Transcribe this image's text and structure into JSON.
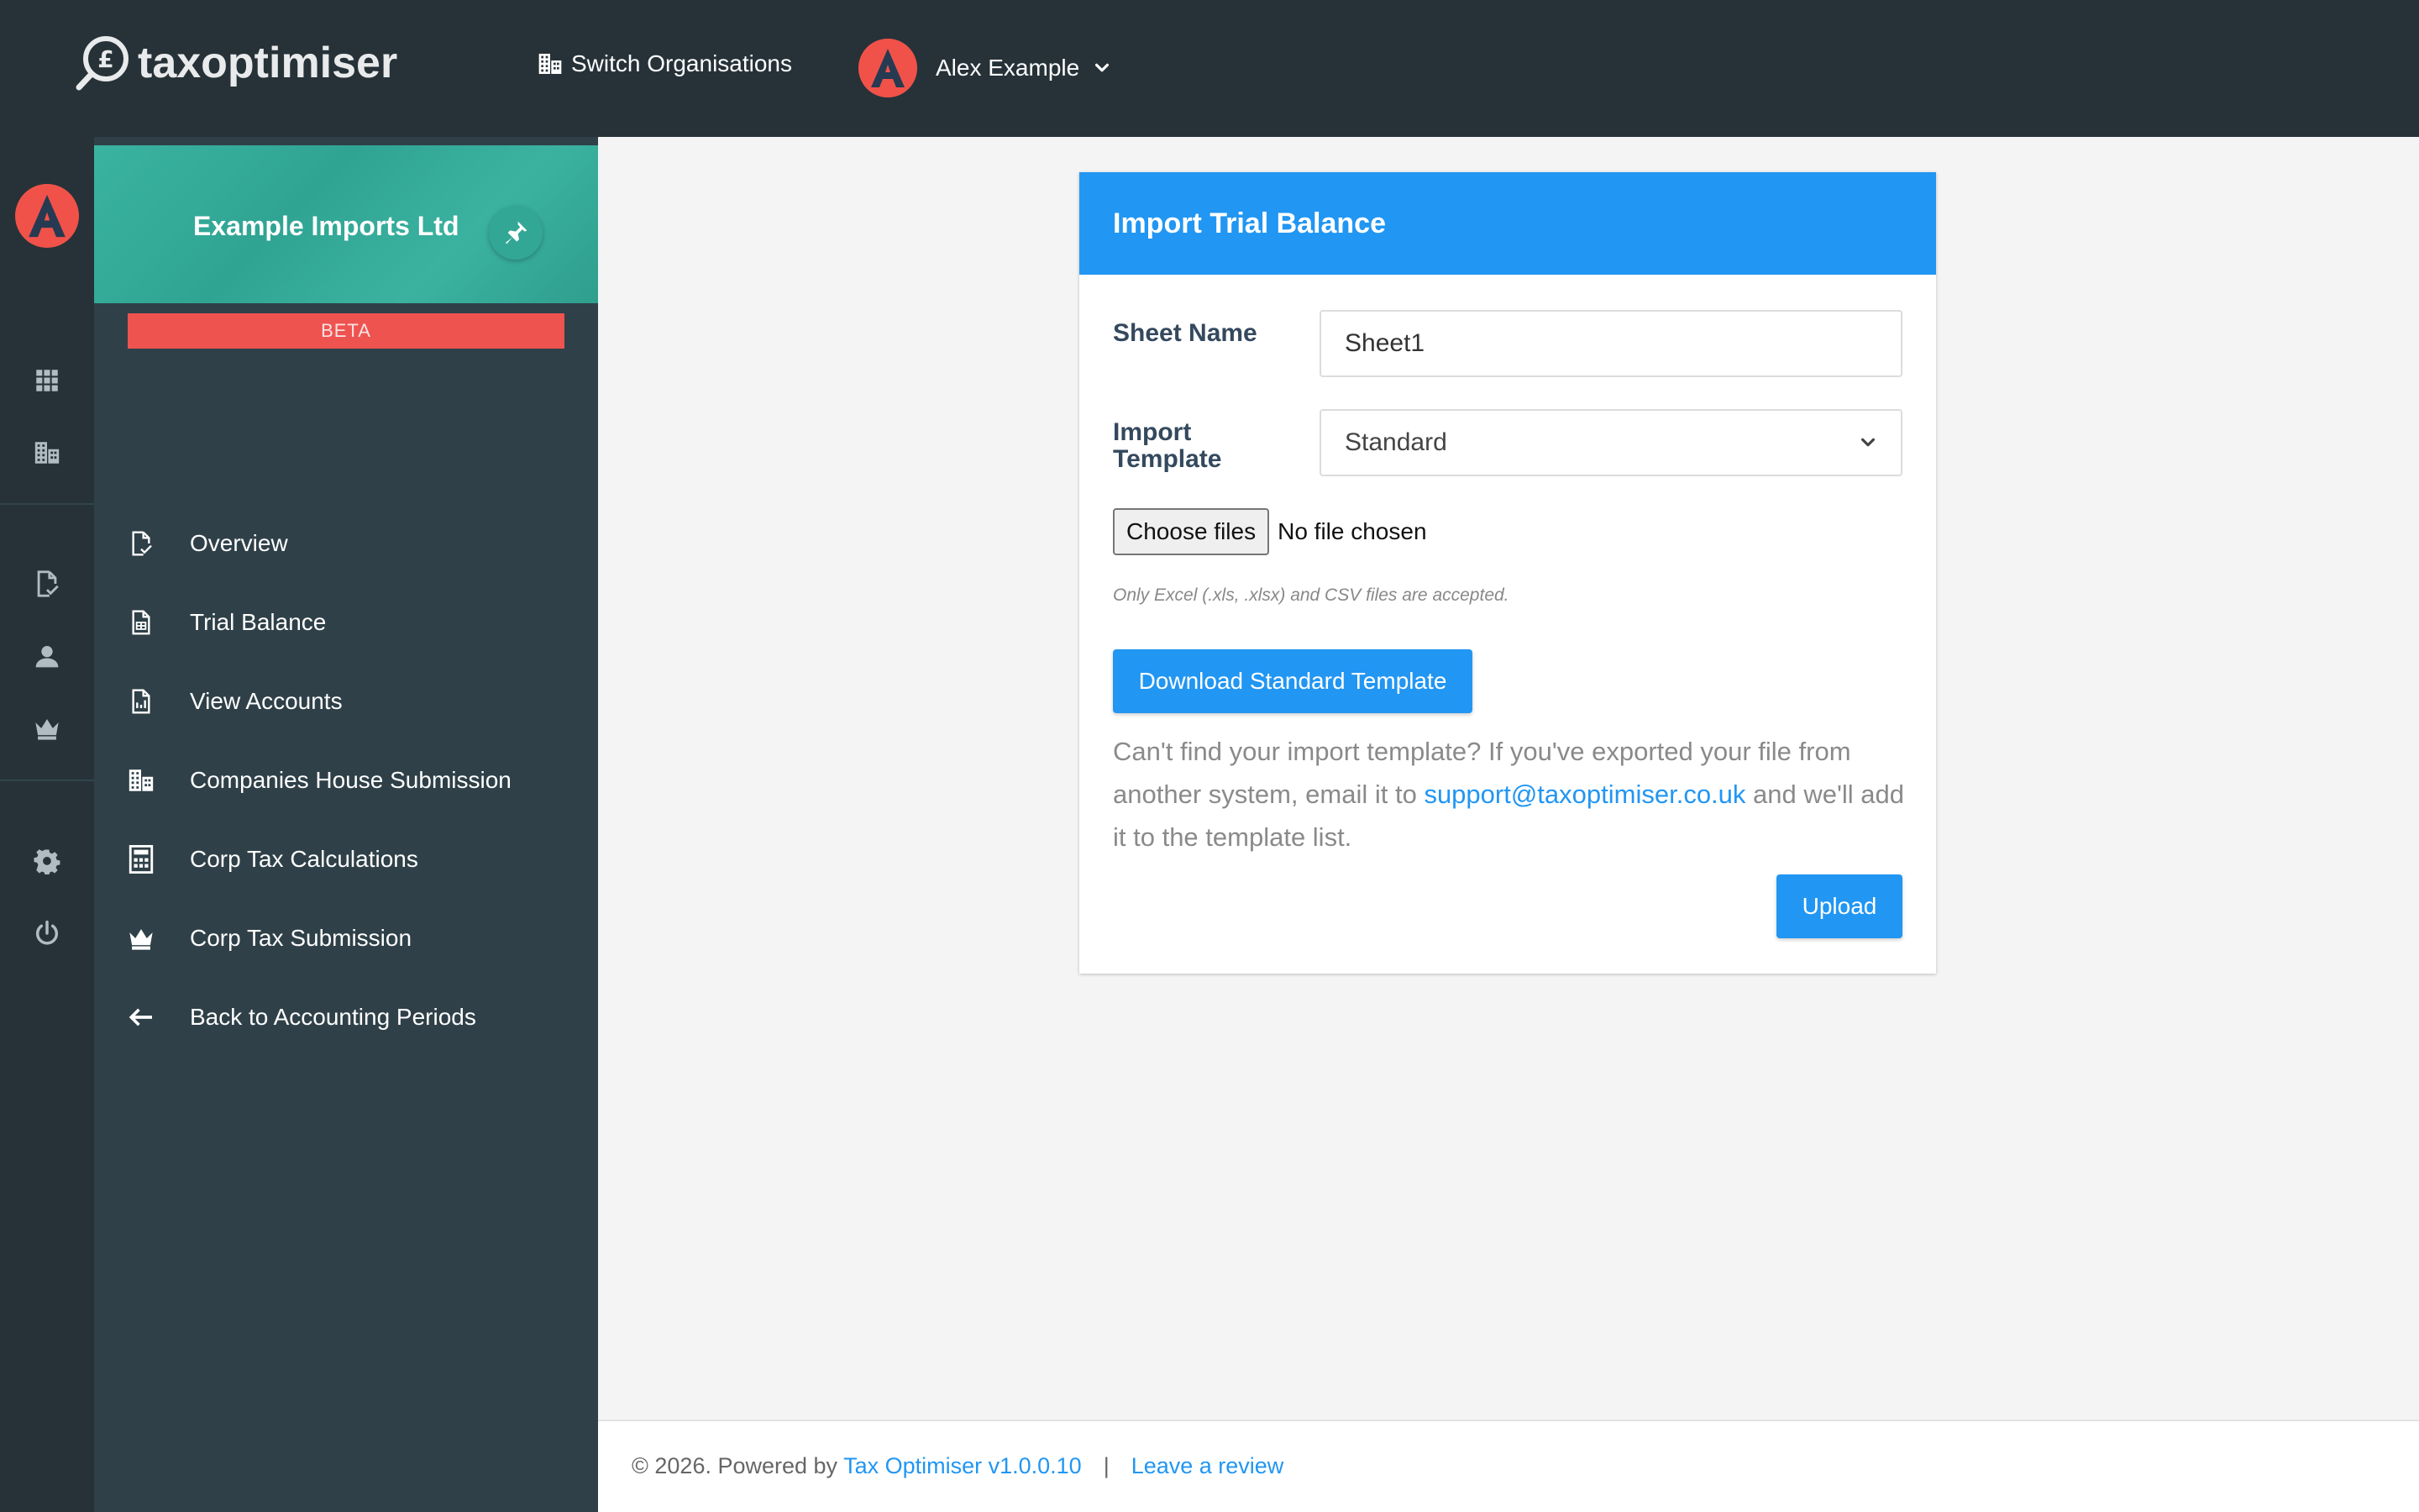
{
  "brand": {
    "name": "taxoptimiser"
  },
  "topbar": {
    "switch_org_label": "Switch Organisations",
    "user_name": "Alex Example",
    "avatar_letter": "A"
  },
  "rail": {
    "avatar_letter": "A",
    "icons": [
      "apps-icon",
      "buildings-icon",
      "document-check-icon",
      "person-icon",
      "crown-icon",
      "gear-icon",
      "power-icon"
    ]
  },
  "sidebar": {
    "org_name": "Example Imports Ltd",
    "badge": "BETA",
    "items": [
      {
        "label": "Overview",
        "icon": "document-check-icon"
      },
      {
        "label": "Trial Balance",
        "icon": "spreadsheet-icon"
      },
      {
        "label": "View Accounts",
        "icon": "report-chart-icon"
      },
      {
        "label": "Companies House Submission",
        "icon": "buildings-icon"
      },
      {
        "label": "Corp Tax Calculations",
        "icon": "calculator-icon"
      },
      {
        "label": "Corp Tax Submission",
        "icon": "crown-icon"
      },
      {
        "label": "Back to Accounting Periods",
        "icon": "arrow-left-icon"
      }
    ]
  },
  "card": {
    "title": "Import Trial Balance",
    "sheet_name_label": "Sheet Name",
    "sheet_name_value": "Sheet1",
    "template_label": "Import Template",
    "template_value": "Standard",
    "file_button": "Choose files",
    "file_status": "No file chosen",
    "hint": "Only Excel (.xls, .xlsx) and CSV files are accepted.",
    "download_button": "Download Standard Template",
    "help_text_before": "Can't find your import template? If you've exported your file from another system, email it to ",
    "help_email": "support@taxoptimiser.co.uk",
    "help_text_after": " and we'll add it to the template list.",
    "upload_button": "Upload"
  },
  "footer": {
    "copyright": "© 2026. Powered by ",
    "product_link": "Tax Optimiser v1.0.0.10",
    "separator": "|",
    "review_link": "Leave a review"
  },
  "colors": {
    "topbar": "#263238",
    "sidebar": "#2f4048",
    "primary": "#2196f3",
    "org_header": "#34ab99",
    "beta": "#ef5350",
    "avatar": "#f0524a"
  }
}
